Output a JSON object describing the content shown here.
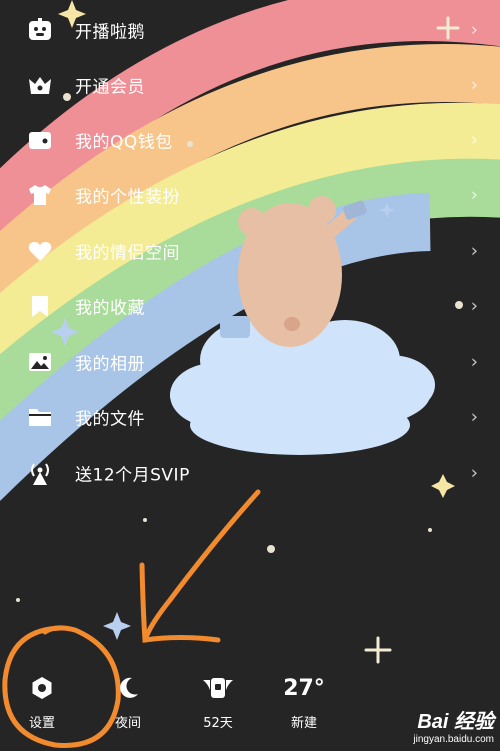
{
  "menu": {
    "items": [
      {
        "label": "开播啦鹅",
        "icon": "penguin-icon"
      },
      {
        "label": "开通会员",
        "icon": "crown-icon"
      },
      {
        "label": "我的QQ钱包",
        "icon": "wallet-icon"
      },
      {
        "label": "我的个性装扮",
        "icon": "tshirt-icon"
      },
      {
        "label": "我的情侣空间",
        "icon": "heart-icon"
      },
      {
        "label": "我的收藏",
        "icon": "bookmark-icon"
      },
      {
        "label": "我的相册",
        "icon": "photo-icon"
      },
      {
        "label": "我的文件",
        "icon": "folder-icon"
      },
      {
        "label": "送12个月SVIP",
        "icon": "broadcast-icon"
      }
    ],
    "chevron": "›"
  },
  "bottom_bar": {
    "settings_label": "设置",
    "night_label": "夜间",
    "days_label": "52天",
    "temperature": "27°",
    "city_label": "新建"
  },
  "watermark": {
    "brand": "Bai 经验",
    "url": "jingyan.baidu.com"
  },
  "colors": {
    "background": "#252525",
    "rainbow": [
      "#ef8f96",
      "#f7c58a",
      "#f4ec94",
      "#a9dc9a",
      "#a8c4e6"
    ],
    "annotation": "#f28a2e",
    "cloud": "#cfe3fa",
    "bear": "#e6bfa4"
  }
}
